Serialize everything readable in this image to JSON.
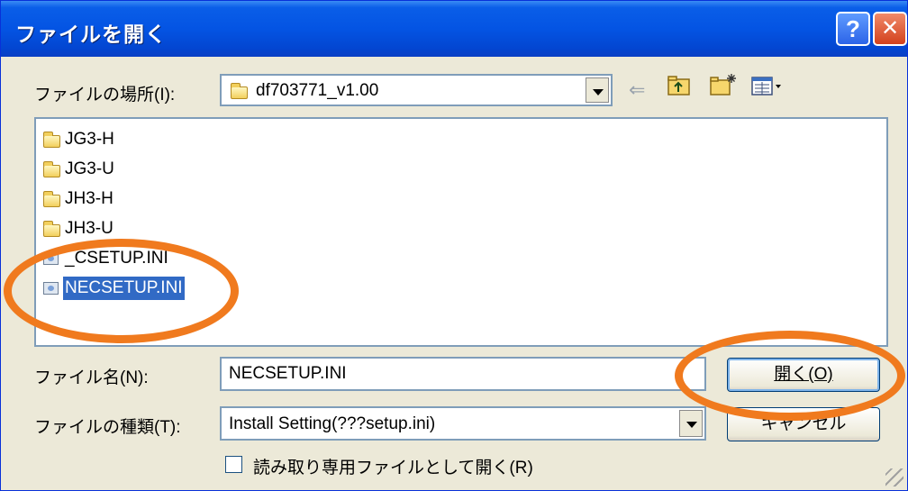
{
  "dialog": {
    "title": "ファイルを開く",
    "help_glyph": "?",
    "close_glyph": "✕"
  },
  "location": {
    "label": "ファイルの場所(I):",
    "value": "df703771_v1.00"
  },
  "toolbar": {
    "back_glyph": "⇐",
    "up_glyph": "⇧",
    "newfolder_glyph": "✱",
    "view_glyph": "▦▾"
  },
  "files": [
    {
      "name": "JG3-H",
      "type": "folder",
      "selected": false
    },
    {
      "name": "JG3-U",
      "type": "folder",
      "selected": false
    },
    {
      "name": "JH3-H",
      "type": "folder",
      "selected": false
    },
    {
      "name": "JH3-U",
      "type": "folder",
      "selected": false
    },
    {
      "name": "_CSETUP.INI",
      "type": "ini",
      "selected": false
    },
    {
      "name": "NECSETUP.INI",
      "type": "ini",
      "selected": true
    }
  ],
  "filename": {
    "label": "ファイル名(N):",
    "value": "NECSETUP.INI"
  },
  "filetype": {
    "label": "ファイルの種類(T):",
    "value": "Install Setting(???setup.ini)"
  },
  "buttons": {
    "open": "開く(O)",
    "cancel": "キャンセル"
  },
  "readonly": {
    "label": "読み取り専用ファイルとして開く(R)",
    "checked": false
  },
  "colors": {
    "titlebar": "#0454e3",
    "dialog_bg": "#ece9d8",
    "selection": "#316ac5",
    "annotation": "#f07a1e"
  }
}
